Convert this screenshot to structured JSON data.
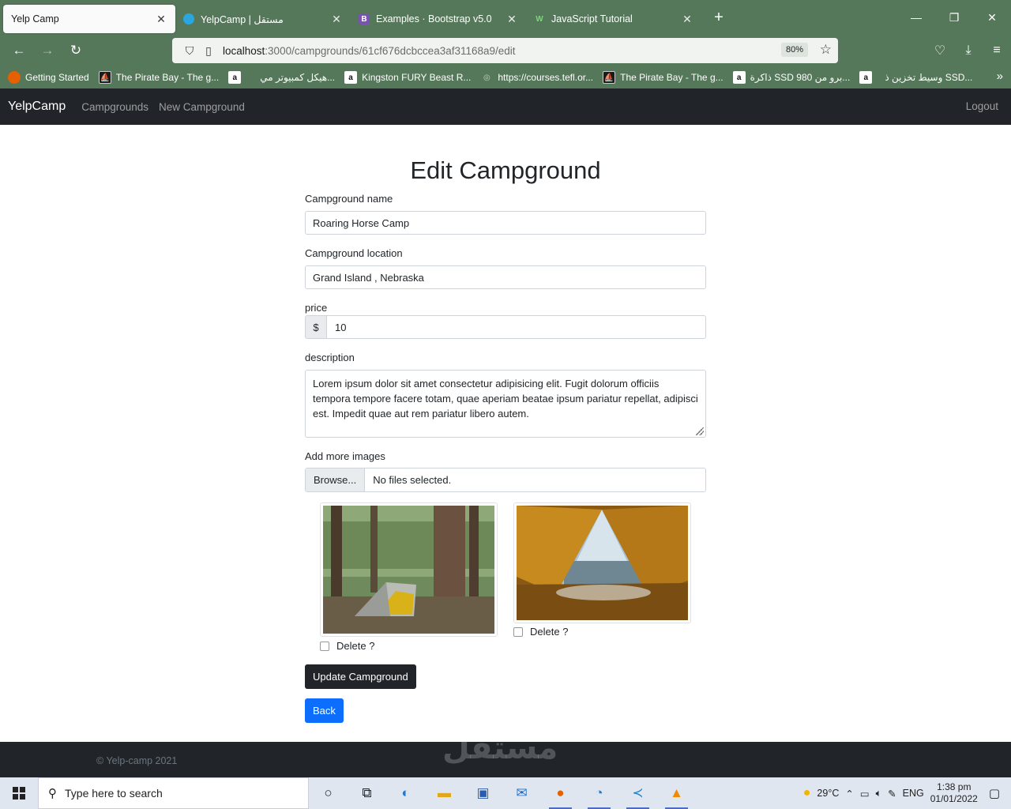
{
  "browser": {
    "tabs": [
      {
        "title": "Yelp Camp",
        "active": true
      },
      {
        "title": "YelpCamp | مستقل",
        "active": false
      },
      {
        "title": "Examples · Bootstrap v5.0",
        "active": false
      },
      {
        "title": "JavaScript Tutorial",
        "active": false
      }
    ],
    "url_host": "localhost",
    "url_path": ":3000/campgrounds/61cf676dcbccea3af31168a9/edit",
    "zoom": "80%",
    "bookmarks": [
      {
        "label": "Getting Started",
        "icon": "firefox-icon"
      },
      {
        "label": "The Pirate Bay - The g...",
        "icon": "piratebay-icon"
      },
      {
        "label": "هيكل كمبيوتر مي...",
        "icon": "amazon-icon"
      },
      {
        "label": "Kingston FURY Beast R...",
        "icon": "amazon-icon"
      },
      {
        "label": "https://courses.tefl.or...",
        "icon": "globe-icon"
      },
      {
        "label": "The Pirate Bay - The g...",
        "icon": "piratebay-icon"
      },
      {
        "label": "ذاكرة SSD 980 برو من...",
        "icon": "amazon-icon"
      },
      {
        "label": "وسيط تخزين ذ SSD...",
        "icon": "amazon-icon"
      }
    ]
  },
  "app": {
    "brand": "YelpCamp",
    "nav": [
      "Campgrounds",
      "New Campground"
    ],
    "logout": "Logout"
  },
  "form": {
    "title": "Edit Campground",
    "name_label": "Campground name",
    "name_value": "Roaring Horse Camp",
    "location_label": "Campground location",
    "location_value": "Grand Island , Nebraska",
    "price_label": "price",
    "price_prefix": "$",
    "price_value": "10",
    "description_label": "description",
    "description_value": "Lorem ipsum dolor sit amet consectetur adipisicing elit. Fugit dolorum officiis tempora tempore facere totam, quae aperiam beatae ipsum pariatur repellat, adipisci est. Impedit quae aut rem pariatur libero autem.",
    "images_label": "Add more images",
    "browse_label": "Browse...",
    "no_files": "No files selected.",
    "delete_label": "Delete ?",
    "update_button": "Update Campground",
    "back_button": "Back"
  },
  "footer": {
    "copyright": "© Yelp-camp 2021"
  },
  "watermark": "مستقل",
  "taskbar": {
    "search_placeholder": "Type here to search",
    "temperature": "29°C",
    "language": "ENG",
    "time": "1:38 pm",
    "date": "01/01/2022"
  }
}
